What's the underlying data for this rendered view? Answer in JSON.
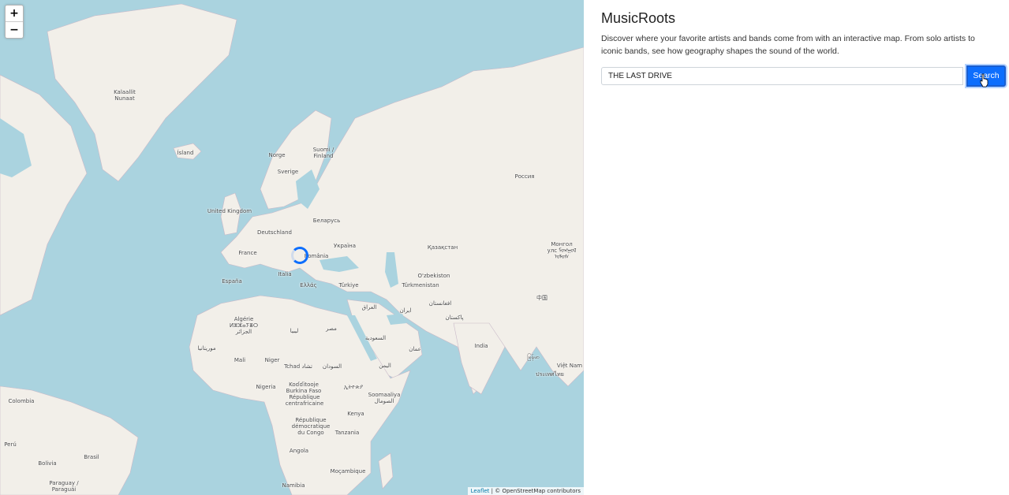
{
  "map": {
    "zoom_in": "+",
    "zoom_out": "−",
    "attribution_link": "Leaflet",
    "attribution_text": "| © OpenStreetMap contributors",
    "labels": [
      {
        "id": "greenland",
        "text": "Kalaallit\nNunaat"
      },
      {
        "id": "iceland",
        "text": "Ísland"
      },
      {
        "id": "norway",
        "text": "Norge"
      },
      {
        "id": "finland",
        "text": "Suomi /\nFinland"
      },
      {
        "id": "sweden",
        "text": "Sverige"
      },
      {
        "id": "russia",
        "text": "Россия"
      },
      {
        "id": "uk",
        "text": "United Kingdom"
      },
      {
        "id": "belarus",
        "text": "Беларусь"
      },
      {
        "id": "germany",
        "text": "Deutschland"
      },
      {
        "id": "ukraine",
        "text": "Україна"
      },
      {
        "id": "france",
        "text": "France"
      },
      {
        "id": "romania",
        "text": "România"
      },
      {
        "id": "kazakhstan",
        "text": "Қазақстан"
      },
      {
        "id": "mongolia",
        "text": "Монгол\nулс ᠮᠣᠩᠭᠣᠯ\nᠤᠯᠤᠰ"
      },
      {
        "id": "italy",
        "text": "Italia"
      },
      {
        "id": "uzbekistan",
        "text": "O'zbekiston"
      },
      {
        "id": "spain",
        "text": "España"
      },
      {
        "id": "greece",
        "text": "Ελλάς"
      },
      {
        "id": "turkey",
        "text": "Türkiye"
      },
      {
        "id": "turkmenistan",
        "text": "Türkmenistan"
      },
      {
        "id": "china",
        "text": "中国"
      },
      {
        "id": "afghanistan",
        "text": "افغانستان"
      },
      {
        "id": "iraq",
        "text": "العراق"
      },
      {
        "id": "iran",
        "text": "ایران"
      },
      {
        "id": "pakistan",
        "text": "پاکستان"
      },
      {
        "id": "algeria",
        "text": "Algérie\nⵍⵣⵣⴰⵢⴻⵔ\nالجزائر"
      },
      {
        "id": "libya",
        "text": "ليبيا"
      },
      {
        "id": "egypt",
        "text": "مصر"
      },
      {
        "id": "saudi",
        "text": "السعودية"
      },
      {
        "id": "india",
        "text": "India"
      },
      {
        "id": "oman",
        "text": "عمان"
      },
      {
        "id": "mauritania",
        "text": "موريتانيا"
      },
      {
        "id": "mali",
        "text": "Mali"
      },
      {
        "id": "niger",
        "text": "Niger"
      },
      {
        "id": "chad",
        "text": "Tchad تشاد"
      },
      {
        "id": "sudan",
        "text": "السودان"
      },
      {
        "id": "yemen",
        "text": "اليمن"
      },
      {
        "id": "myanmar",
        "text": "မြန်မာ"
      },
      {
        "id": "vietnam",
        "text": "Việt Nam"
      },
      {
        "id": "thailand",
        "text": "ประเทศไทย"
      },
      {
        "id": "nigeria",
        "text": "Nigeria"
      },
      {
        "id": "ethiopia",
        "text": "ኢትዮጵያ"
      },
      {
        "id": "burkina",
        "text": "Koɗɗitooje\nBurkina Faso"
      },
      {
        "id": "somalia",
        "text": "Soomaaliya\nالصومال"
      },
      {
        "id": "car",
        "text": "République\ncentrafricaine"
      },
      {
        "id": "colombia",
        "text": "Colombia"
      },
      {
        "id": "kenya",
        "text": "Kenya"
      },
      {
        "id": "drc",
        "text": "République\ndémocratique\ndu Congo"
      },
      {
        "id": "tanzania",
        "text": "Tanzania"
      },
      {
        "id": "peru",
        "text": "Perú"
      },
      {
        "id": "brasil",
        "text": "Brasil"
      },
      {
        "id": "angola",
        "text": "Angola"
      },
      {
        "id": "bolivia",
        "text": "Bolivia"
      },
      {
        "id": "mozambique",
        "text": "Moçambique"
      },
      {
        "id": "paraguay",
        "text": "Paraguay /\nParaguái"
      },
      {
        "id": "namibia",
        "text": "Namibia"
      }
    ]
  },
  "panel": {
    "title": "MusicRoots",
    "description": "Discover where your favorite artists and bands come from with an interactive map. From solo artists to iconic bands, see how geography shapes the sound of the world.",
    "search_value": "THE LAST DRIVE",
    "search_label": "Search"
  },
  "colors": {
    "water": "#aad3df",
    "land": "#f2efe9",
    "accent": "#0d6efd"
  }
}
